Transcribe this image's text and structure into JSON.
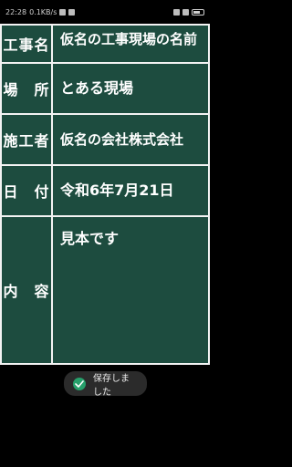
{
  "status_bar": {
    "time": "22:28",
    "net": "0.1KB/s",
    "battery": "battery-icon",
    "wifi": "wifi-icon",
    "signal": "signal-icon"
  },
  "board": {
    "rows": [
      {
        "label": "工事名",
        "value": "仮名の工事現場の名前"
      },
      {
        "label": "場　所",
        "value": "とある現場"
      },
      {
        "label": "施工者",
        "value": "仮名の会社株式会社"
      },
      {
        "label": "日　付",
        "value": "令和6年7月21日"
      },
      {
        "label": "内　容",
        "value": "見本です"
      }
    ]
  },
  "toast": {
    "icon": "app-icon",
    "text": "保存しました"
  }
}
